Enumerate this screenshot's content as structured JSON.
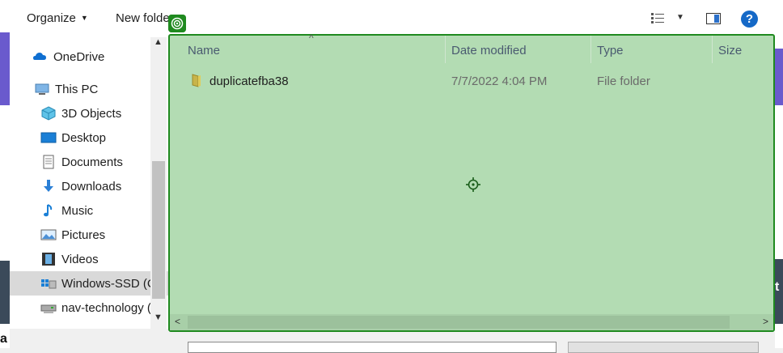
{
  "toolbar": {
    "organize_label": "Organize",
    "new_folder_label": "New folder",
    "view_icon": "details-view-icon",
    "preview_pane_icon": "preview-pane-icon",
    "help_label": "?"
  },
  "sidebar": {
    "items": [
      {
        "label": "OneDrive",
        "icon": "onedrive-icon"
      },
      {
        "label": "This PC",
        "icon": "this-pc-icon"
      },
      {
        "label": "3D Objects",
        "icon": "3d-objects-icon"
      },
      {
        "label": "Desktop",
        "icon": "desktop-icon"
      },
      {
        "label": "Documents",
        "icon": "documents-icon"
      },
      {
        "label": "Downloads",
        "icon": "downloads-icon"
      },
      {
        "label": "Music",
        "icon": "music-icon"
      },
      {
        "label": "Pictures",
        "icon": "pictures-icon"
      },
      {
        "label": "Videos",
        "icon": "videos-icon"
      },
      {
        "label": "Windows-SSD (C",
        "icon": "drive-icon"
      },
      {
        "label": "nav-technology (",
        "icon": "network-drive-icon"
      }
    ]
  },
  "columns": {
    "name": "Name",
    "date_modified": "Date modified",
    "type": "Type",
    "size": "Size"
  },
  "files": [
    {
      "name": "duplicatefba38",
      "date": "7/7/2022 4:04 PM",
      "type": "File folder"
    }
  ],
  "background": {
    "left_char": "a",
    "right_char": "t"
  },
  "colors": {
    "accent": "#1569c7",
    "highlight_overlay": "#b3dcb3",
    "highlight_border": "#1f8a1f"
  }
}
